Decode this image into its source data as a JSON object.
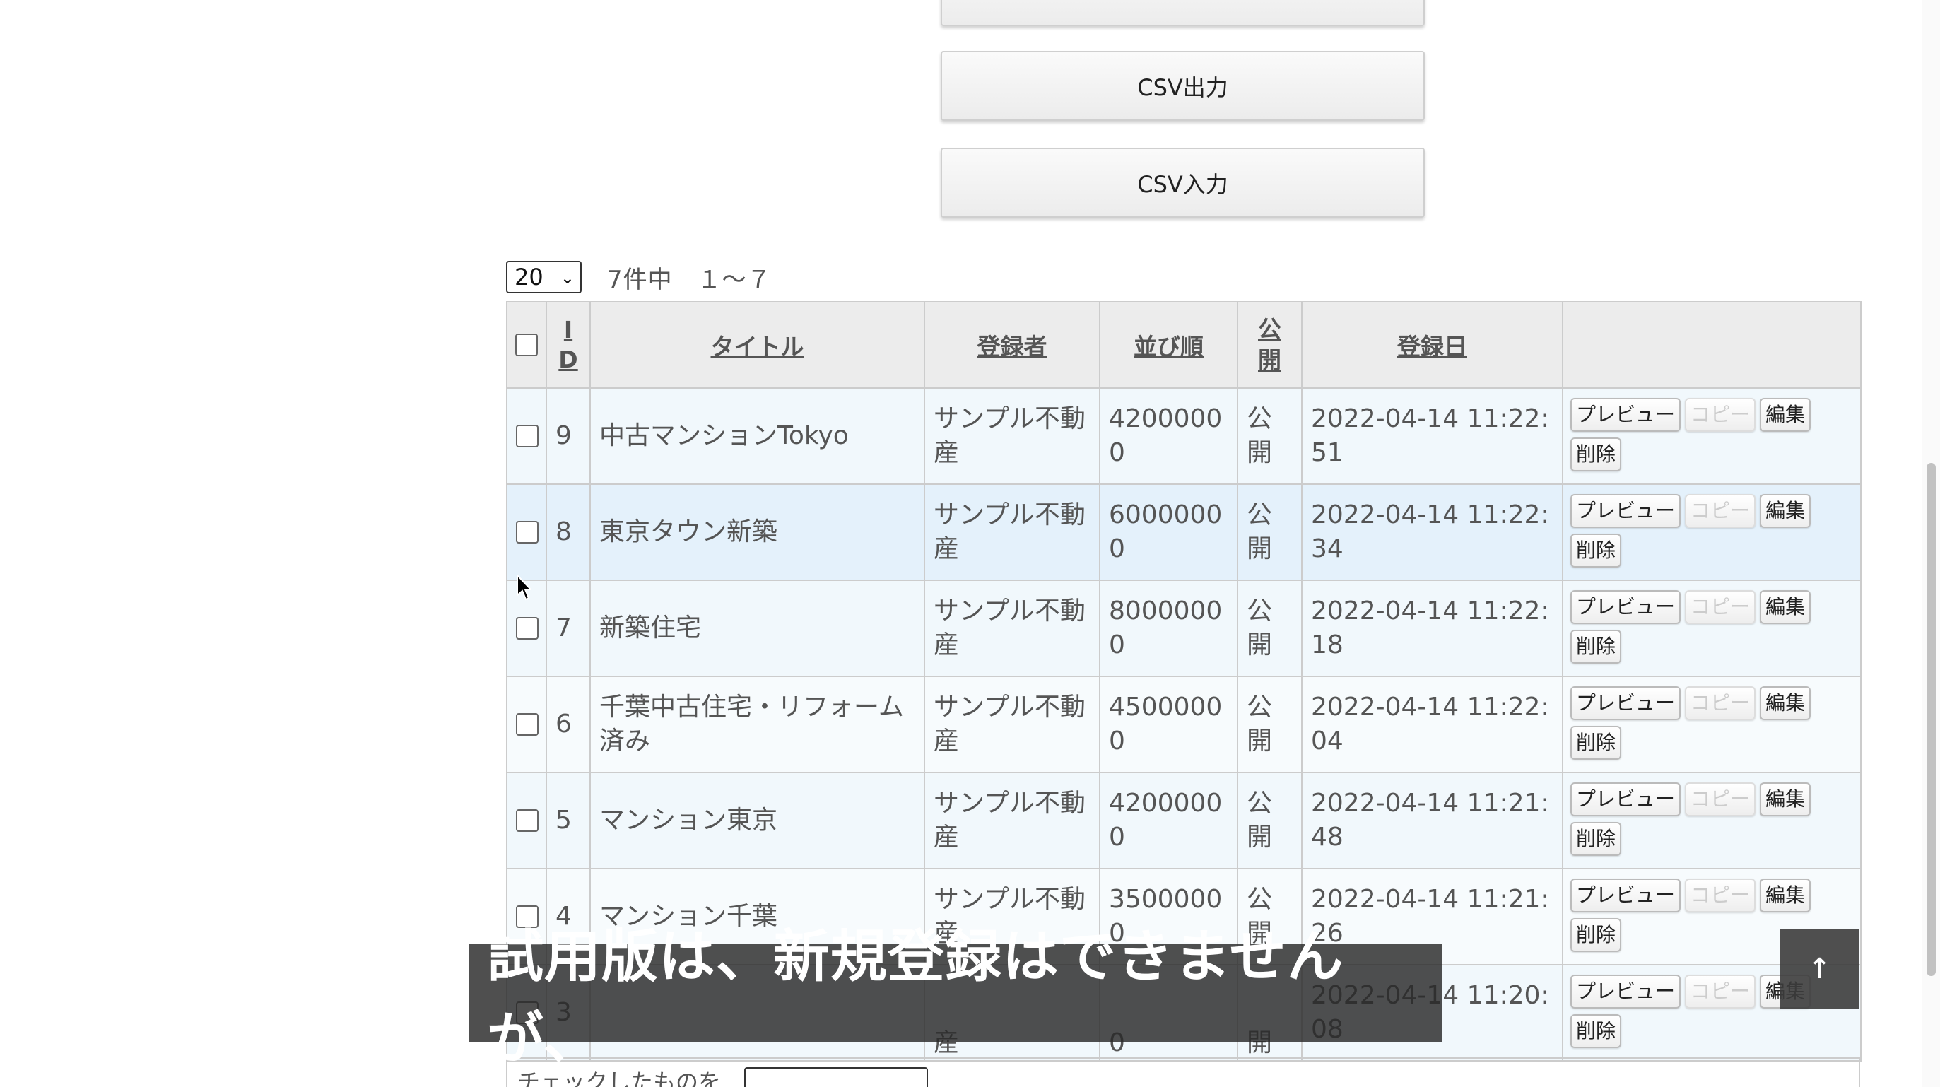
{
  "buttons": {
    "top_partial": "",
    "csv_export": "CSV出力",
    "csv_import": "CSV入力"
  },
  "pager": {
    "per_page": "20",
    "summary": "7件中　１～７"
  },
  "table": {
    "headers": {
      "id_1": "I",
      "id_2": "D",
      "title": "タイトル",
      "registrant": "登録者",
      "order": "並び順",
      "public_1": "公",
      "public_2": "開",
      "date": "登録日"
    },
    "rows": [
      {
        "id": "9",
        "title": "中古マンションTokyo",
        "registrant": "サンプル不動産",
        "order": "42000000",
        "public": "公開",
        "date": "2022-04-14 11:22:51"
      },
      {
        "id": "8",
        "title": "東京タウン新築",
        "registrant": "サンプル不動産",
        "order": "60000000",
        "public": "公開",
        "date": "2022-04-14 11:22:34"
      },
      {
        "id": "7",
        "title": "新築住宅",
        "registrant": "サンプル不動産",
        "order": "80000000",
        "public": "公開",
        "date": "2022-04-14 11:22:18"
      },
      {
        "id": "6",
        "title": "千葉中古住宅・リフォーム済み",
        "registrant": "サンプル不動産",
        "order": "45000000",
        "public": "公開",
        "date": "2022-04-14 11:22:04"
      },
      {
        "id": "5",
        "title": "マンション東京",
        "registrant": "サンプル不動産",
        "order": "42000000",
        "public": "公開",
        "date": "2022-04-14 11:21:48"
      },
      {
        "id": "4",
        "title": "マンション千葉",
        "registrant": "サンプル不動産",
        "order": "35000000",
        "public": "公開",
        "date": "2022-04-14 11:21:26"
      },
      {
        "id": "3",
        "title": "",
        "registrant": "産",
        "order": "0",
        "public": "開",
        "date": "2022-04-14 11:20:08"
      }
    ],
    "actions": {
      "preview": "プレビュー",
      "copy": "コピー",
      "edit": "編集",
      "delete": "削除"
    }
  },
  "bulk": {
    "label": "チェックしたものを"
  },
  "caption": "試用版は、新規登録はできませんが、",
  "to_top": "↑"
}
